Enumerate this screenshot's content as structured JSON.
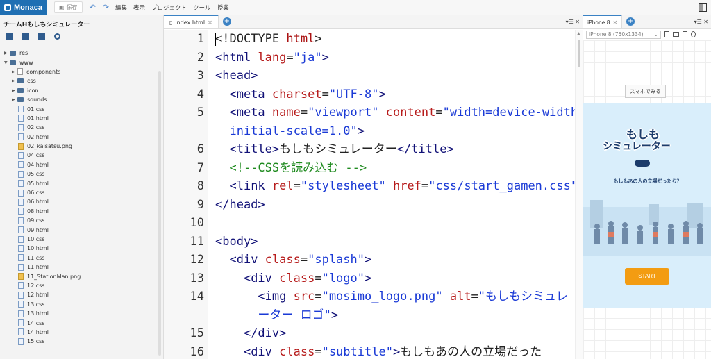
{
  "app": {
    "brand": "Monaca"
  },
  "toolbar": {
    "save_label": "保存",
    "menus": [
      "編集",
      "表示",
      "プロジェクト",
      "ツール",
      "授業"
    ]
  },
  "sidebar": {
    "project_title": "チームHもしもシミュレーター",
    "tree": [
      {
        "label": "res",
        "type": "folder",
        "level": 0,
        "arrow": "▶"
      },
      {
        "label": "www",
        "type": "folder",
        "level": 0,
        "arrow": "▼"
      },
      {
        "label": "components",
        "type": "package",
        "level": 1,
        "arrow": "▶"
      },
      {
        "label": "css",
        "type": "folder",
        "level": 1,
        "arrow": "▶"
      },
      {
        "label": "icon",
        "type": "folder",
        "level": 1,
        "arrow": "▶"
      },
      {
        "label": "sounds",
        "type": "folder",
        "level": 1,
        "arrow": "▶"
      },
      {
        "label": "01.css",
        "type": "file",
        "level": 2
      },
      {
        "label": "01.html",
        "type": "file",
        "level": 2
      },
      {
        "label": "02.css",
        "type": "file",
        "level": 2
      },
      {
        "label": "02.html",
        "type": "file",
        "level": 2
      },
      {
        "label": "02_kaisatsu.png",
        "type": "image",
        "level": 2
      },
      {
        "label": "04.css",
        "type": "file",
        "level": 2
      },
      {
        "label": "04.html",
        "type": "file",
        "level": 2
      },
      {
        "label": "05.css",
        "type": "file",
        "level": 2
      },
      {
        "label": "05.html",
        "type": "file",
        "level": 2
      },
      {
        "label": "06.css",
        "type": "file",
        "level": 2
      },
      {
        "label": "06.html",
        "type": "file",
        "level": 2
      },
      {
        "label": "08.html",
        "type": "file",
        "level": 2
      },
      {
        "label": "09.css",
        "type": "file",
        "level": 2
      },
      {
        "label": "09.html",
        "type": "file",
        "level": 2
      },
      {
        "label": "10.css",
        "type": "file",
        "level": 2
      },
      {
        "label": "10.html",
        "type": "file",
        "level": 2
      },
      {
        "label": "11.css",
        "type": "file",
        "level": 2
      },
      {
        "label": "11.html",
        "type": "file",
        "level": 2
      },
      {
        "label": "11_StationMan.png",
        "type": "image",
        "level": 2
      },
      {
        "label": "12.css",
        "type": "file",
        "level": 2
      },
      {
        "label": "12.html",
        "type": "file",
        "level": 2
      },
      {
        "label": "13.css",
        "type": "file",
        "level": 2
      },
      {
        "label": "13.html",
        "type": "file",
        "level": 2
      },
      {
        "label": "14.css",
        "type": "file",
        "level": 2
      },
      {
        "label": "14.html",
        "type": "file",
        "level": 2
      },
      {
        "label": "15.css",
        "type": "file",
        "level": 2
      }
    ]
  },
  "editor": {
    "tab_label": "index.html",
    "lines": [
      {
        "no": "1",
        "html": "<span class='p'>&lt;!DOCTYPE </span><span class='k'>html</span><span class='p'>&gt;</span>"
      },
      {
        "no": "2",
        "html": "<span class='t'>&lt;html </span><span class='a'>lang</span><span class='p'>=</span><span class='s'>\"ja\"</span><span class='t'>&gt;</span>"
      },
      {
        "no": "3",
        "html": "<span class='t'>&lt;head&gt;</span>"
      },
      {
        "no": "4",
        "html": "  <span class='t'>&lt;meta </span><span class='a'>charset</span><span class='p'>=</span><span class='s'>\"UTF-8\"</span><span class='t'>&gt;</span>"
      },
      {
        "no": "5",
        "html": "  <span class='t'>&lt;meta </span><span class='a'>name</span><span class='p'>=</span><span class='s'>\"viewport\"</span> <span class='a'>content</span><span class='p'>=</span><span class='s'>\"width=device-width,</span>"
      },
      {
        "no": "",
        "html": "  <span class='s'>initial-scale=1.0\"</span><span class='t'>&gt;</span>"
      },
      {
        "no": "6",
        "html": "  <span class='t'>&lt;title&gt;</span><span class='p'>もしもシミュレーター</span><span class='t'>&lt;/title&gt;</span>"
      },
      {
        "no": "7",
        "html": "  <span class='c'>&lt;!--CSSを読み込む --&gt;</span>"
      },
      {
        "no": "8",
        "html": "  <span class='t'>&lt;link </span><span class='a'>rel</span><span class='p'>=</span><span class='s'>\"stylesheet\"</span> <span class='a'>href</span><span class='p'>=</span><span class='s'>\"css/start_gamen.css\"</span><span class='t'>&gt;</span>"
      },
      {
        "no": "9",
        "html": "<span class='t'>&lt;/head&gt;</span>"
      },
      {
        "no": "10",
        "html": ""
      },
      {
        "no": "11",
        "html": "<span class='t'>&lt;body&gt;</span>"
      },
      {
        "no": "12",
        "html": "  <span class='t'>&lt;div </span><span class='a'>class</span><span class='p'>=</span><span class='s'>\"splash\"</span><span class='t'>&gt;</span>"
      },
      {
        "no": "13",
        "html": "    <span class='t'>&lt;div </span><span class='a'>class</span><span class='p'>=</span><span class='s'>\"logo\"</span><span class='t'>&gt;</span>"
      },
      {
        "no": "14",
        "html": "      <span class='t'>&lt;img </span><span class='a'>src</span><span class='p'>=</span><span class='s'>\"mosimo_logo.png\"</span> <span class='a'>alt</span><span class='p'>=</span><span class='s'>\"もしもシミュレ</span>"
      },
      {
        "no": "",
        "html": "      <span class='s'>ーター ロゴ\"</span><span class='t'>&gt;</span>"
      },
      {
        "no": "15",
        "html": "    <span class='t'>&lt;/div&gt;</span>"
      },
      {
        "no": "16",
        "html": "    <span class='t'>&lt;div </span><span class='a'>class</span><span class='p'>=</span><span class='s'>\"subtitle\"</span><span class='t'>&gt;</span><span class='p'>もしもあの人の立場だった</span>"
      }
    ]
  },
  "preview": {
    "tab_label": "iPhone 8",
    "device_select": "iPhone 8 (750x1334)",
    "try_button": "スマホでみる",
    "app_logo_line1": "もしも",
    "app_logo_line2": "シミュレーター",
    "app_subtitle": "もしもあの人の立場だったら？",
    "start_button": "START"
  }
}
